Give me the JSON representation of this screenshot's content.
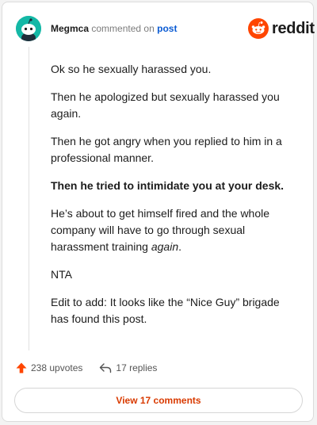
{
  "header": {
    "username": "Megmca",
    "commented_text": "commented on",
    "post_link": "post",
    "logo_word": "reddit"
  },
  "comment": {
    "paragraphs": [
      {
        "text": "Ok so he sexually harassed you."
      },
      {
        "text": "Then he apologized but sexually harassed you again."
      },
      {
        "text": "Then he got angry when you replied to him in a professional manner."
      },
      {
        "text": "Then he tried to intimidate you at your desk."
      },
      {
        "before": "He’s about to get himself fired and the whole company will have to go through sexual harassment training ",
        "emphasis": "again",
        "after": "."
      },
      {
        "text": "NTA"
      },
      {
        "text": "Edit to add: It looks like the “Nice Guy” brigade has found this post."
      }
    ]
  },
  "actions": {
    "upvotes": "238 upvotes",
    "replies": "17 replies",
    "view_comments": "View 17 comments"
  },
  "colors": {
    "reddit_orange": "#ff4500",
    "avatar_bg": "#14b8a6",
    "link_blue": "#0a5bd3",
    "view_button_text": "#d93a00"
  },
  "icons": {
    "avatar": "snoo-avatar-icon",
    "logo": "reddit-snoo-icon",
    "upvote": "upvote-arrow-icon",
    "reply": "reply-arrow-icon"
  }
}
